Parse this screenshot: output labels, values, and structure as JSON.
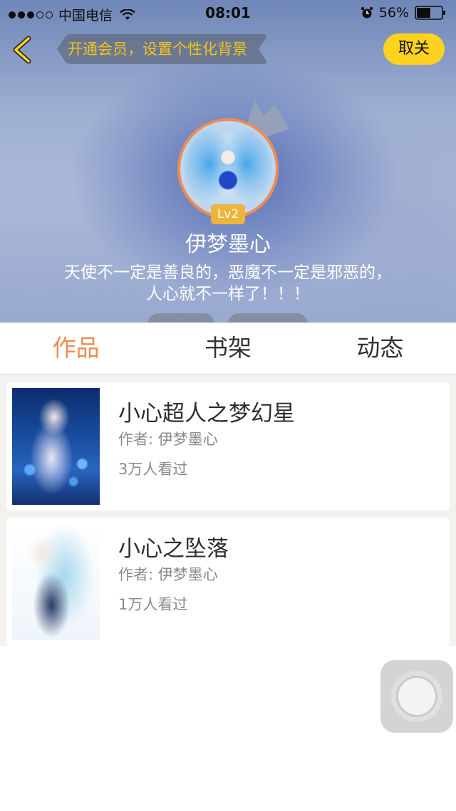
{
  "status_bar": {
    "carrier": "中国电信",
    "time": "08:01",
    "battery": "56%"
  },
  "header": {
    "vip_banner": "开通会员，设置个性化背景",
    "unfollow_label": "取关",
    "level": "Lv2",
    "username": "伊梦墨心",
    "bio_line1": "天使不一定是善良的，恶魔不一定是邪恶的，",
    "bio_line2": "人心就不一样了！！！"
  },
  "tabs": [
    {
      "label": "作品",
      "active": true
    },
    {
      "label": "书架",
      "active": false
    },
    {
      "label": "动态",
      "active": false
    }
  ],
  "books": [
    {
      "title": "小心超人之梦幻星",
      "author": "作者: 伊梦墨心",
      "views": "3万人看过"
    },
    {
      "title": "小心之坠落",
      "author": "作者: 伊梦墨心",
      "views": "1万人看过"
    }
  ],
  "colors": {
    "accent": "#ef8c52",
    "unfollow_button": "#ffd21f",
    "banner_text": "#f2c31d"
  }
}
